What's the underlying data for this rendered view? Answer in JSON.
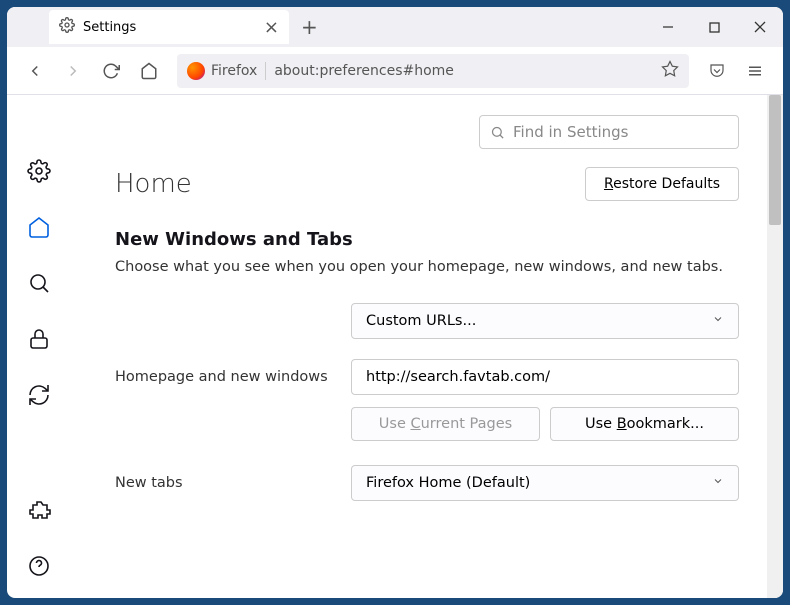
{
  "tab": {
    "title": "Settings"
  },
  "url": {
    "identity": "Firefox",
    "address": "about:preferences#home"
  },
  "search": {
    "placeholder": "Find in Settings"
  },
  "page": {
    "title": "Home",
    "restore_label": "Restore Defaults"
  },
  "section": {
    "title": "New Windows and Tabs",
    "desc": "Choose what you see when you open your homepage, new windows, and new tabs."
  },
  "homepage": {
    "select_label": "Custom URLs...",
    "row_label": "Homepage and new windows",
    "url_value": "http://search.favtab.com/",
    "use_current": "Use Current Pages",
    "use_bookmark": "Use Bookmark..."
  },
  "newtabs": {
    "row_label": "New tabs",
    "select_label": "Firefox Home (Default)"
  }
}
